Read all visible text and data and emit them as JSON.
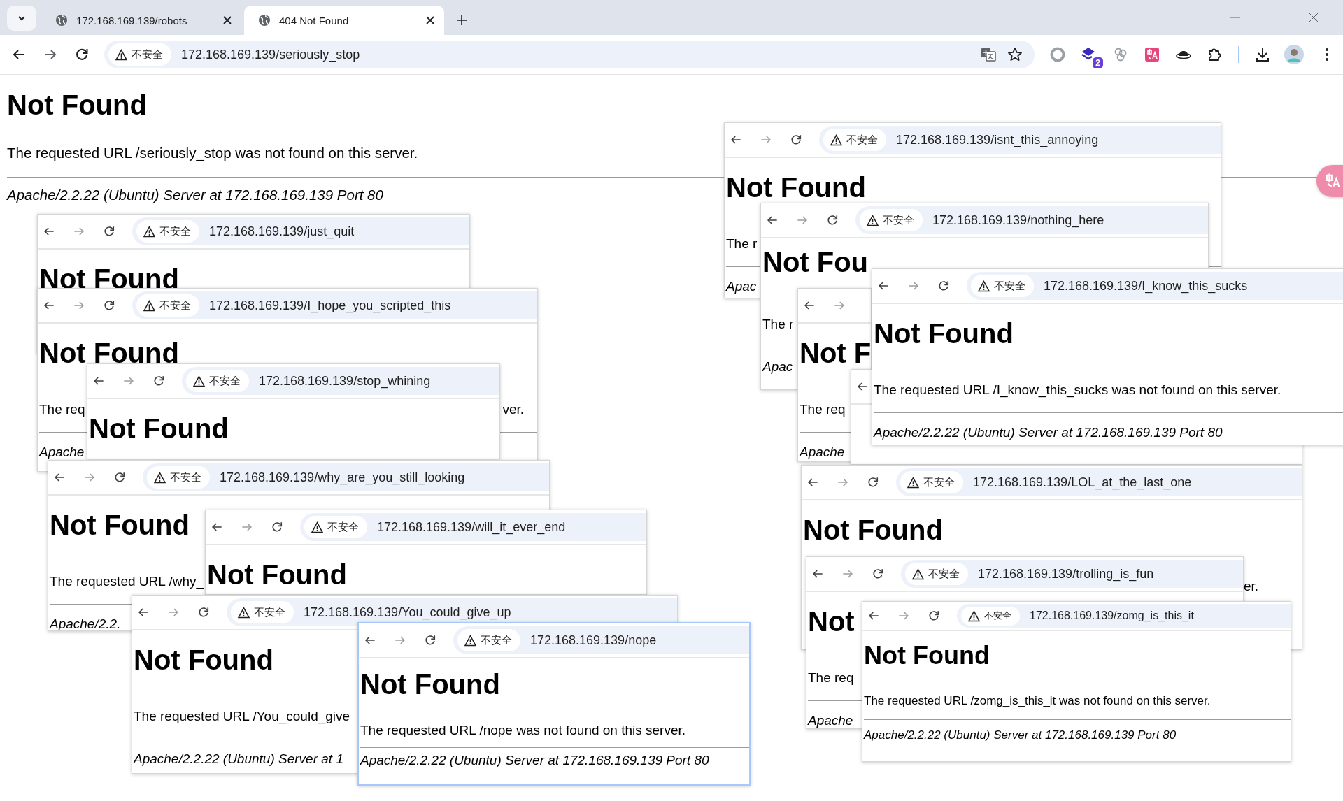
{
  "browser": {
    "tabs": [
      {
        "title": "172.168.169.139/robots",
        "selected": false
      },
      {
        "title": "404 Not Found",
        "selected": true
      }
    ],
    "security_label": "不安全",
    "address": "172.168.169.139/seriously_stop",
    "extension_badge": "2"
  },
  "page": {
    "heading": "Not Found",
    "message": "The requested URL /seriously_stop was not found on this server.",
    "footer": "Apache/2.2.22 (Ubuntu) Server at 172.168.169.139 Port 80"
  },
  "screenshots": [
    {
      "security_label": "不安全",
      "address": "172.168.169.139/just_quit",
      "heading": "Not Found",
      "focused": false
    },
    {
      "security_label": "不安全",
      "address": "172.168.169.139/I_hope_you_scripted_this",
      "heading": "Not Found",
      "message": "The req",
      "message_end": "ver.",
      "footer": "Apache",
      "focused": false
    },
    {
      "security_label": "不安全",
      "address": "172.168.169.139/stop_whining",
      "heading": "Not Found",
      "focused": false
    },
    {
      "security_label": "不安全",
      "address": "172.168.169.139/why_are_you_still_looking",
      "heading": "Not Found",
      "message": "The requested URL /why_",
      "footer": "Apache/2.2.",
      "focused": false
    },
    {
      "security_label": "不安全",
      "address": "172.168.169.139/will_it_ever_end",
      "heading": "Not Found",
      "focused": false
    },
    {
      "security_label": "不安全",
      "address": "172.168.169.139/You_could_give_up",
      "heading": "Not Found",
      "message": "The requested URL /You_could_give",
      "footer": "Apache/2.2.22 (Ubuntu) Server at 1",
      "focused": false
    },
    {
      "security_label": "不安全",
      "address": "172.168.169.139/nope",
      "heading": "Not Found",
      "message": "The requested URL /nope was not found on this server.",
      "footer": "Apache/2.2.22 (Ubuntu) Server at 172.168.169.139 Port 80",
      "focused": true
    },
    {
      "security_label": "不安全",
      "address": "172.168.169.139/isnt_this_annoying",
      "heading": "Not Found",
      "message": "The r",
      "footer": "Apac",
      "focused": false
    },
    {
      "security_label": "不安全",
      "address": "172.168.169.139/nothing_here",
      "heading": "Not Fou",
      "message": "The r",
      "footer": "Apac",
      "focused": false
    },
    {
      "heading": "Not F",
      "message": "The req",
      "footer": "Apache",
      "focused": false
    },
    {
      "focused": false
    },
    {
      "security_label": "不安全",
      "address": "172.168.169.139/I_know_this_sucks",
      "heading": "Not Found",
      "message": "The requested URL /I_know_this_sucks was not found on this server.",
      "footer": "Apache/2.2.22 (Ubuntu) Server at 172.168.169.139 Port 80",
      "focused": false
    },
    {
      "security_label": "不安全",
      "address": "172.168.169.139/LOL_at_the_last_one",
      "heading": "Not Found",
      "message_end": "er.",
      "focused": false
    },
    {
      "security_label": "不安全",
      "address": "172.168.169.139/trolling_is_fun",
      "heading": "Not",
      "message": "The req",
      "footer": "Apache",
      "focused": false
    },
    {
      "security_label": "不安全",
      "address": "172.168.169.139/zomg_is_this_it",
      "heading": "Not Found",
      "message": "The requested URL /zomg_is_this_it was not found on this server.",
      "footer": "Apache/2.2.22 (Ubuntu) Server at 172.168.169.139 Port 80",
      "focused": false
    }
  ]
}
